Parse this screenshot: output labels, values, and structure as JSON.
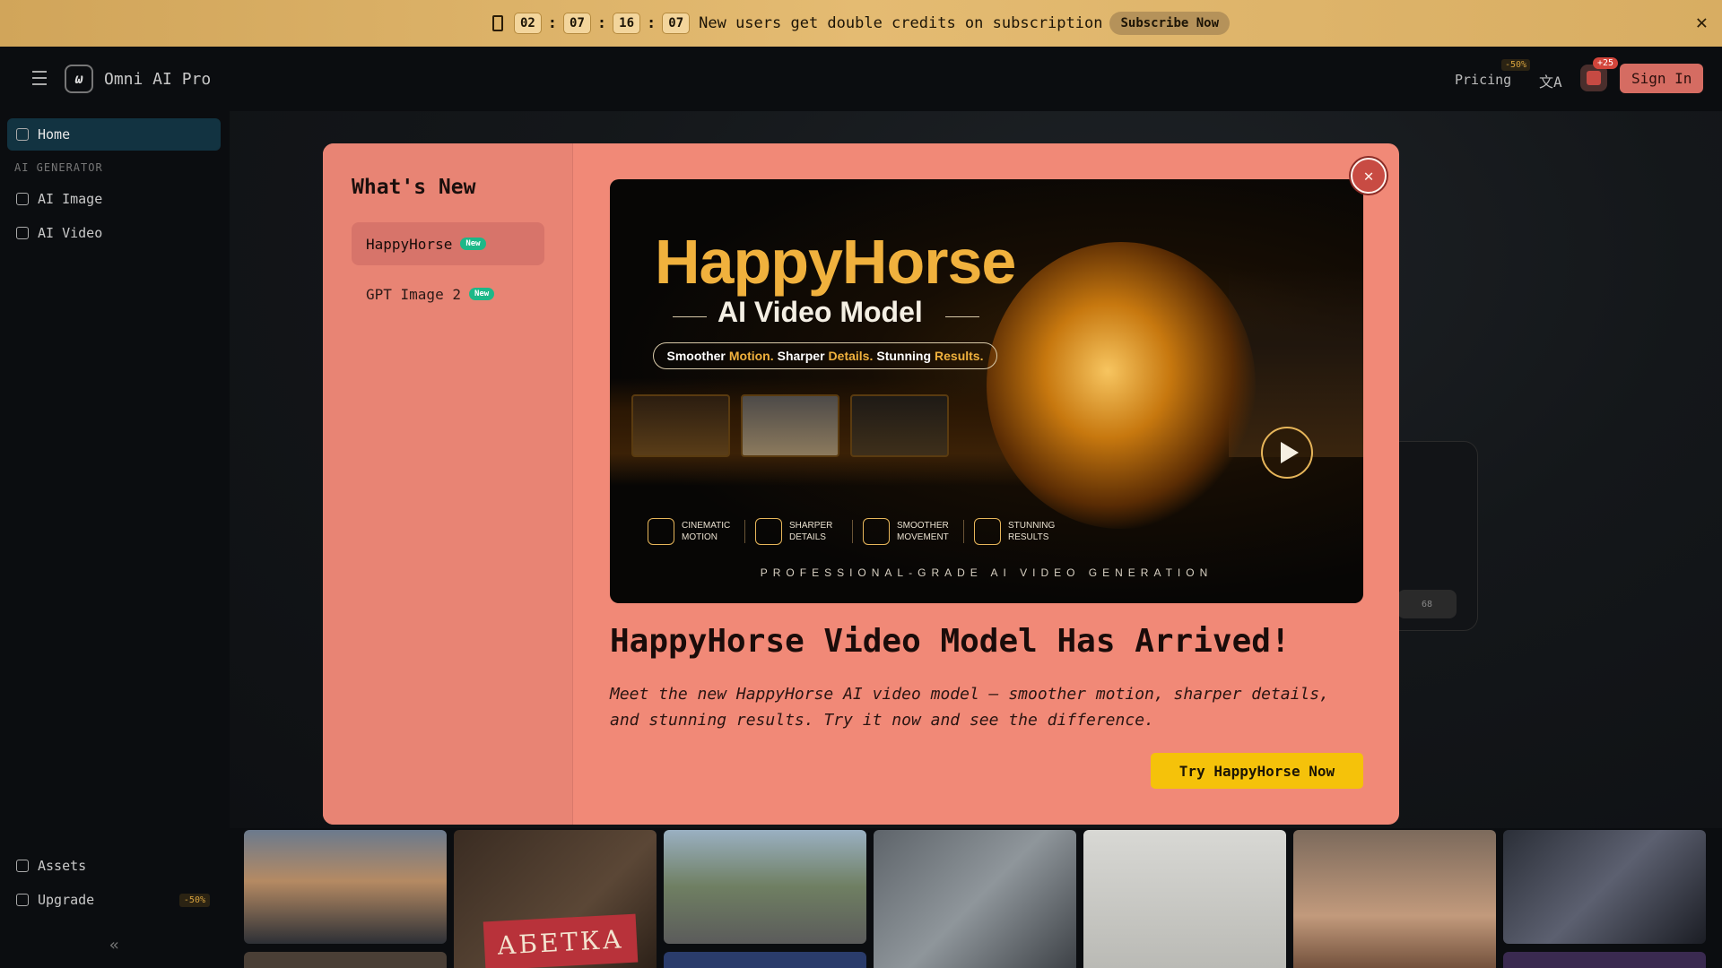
{
  "promo": {
    "timer": [
      "02",
      "07",
      "16",
      "07"
    ],
    "message": "New users get double credits on subscription",
    "button": "Subscribe Now",
    "close": "✕"
  },
  "header": {
    "brand": "Omni AI Pro",
    "logo_glyph": "ω",
    "pricing": "Pricing",
    "pricing_badge": "-50%",
    "translate_glyph": "文A",
    "gift_badge": "+25",
    "signin": "Sign In"
  },
  "sidebar": {
    "home": "Home",
    "section": "AI GENERATOR",
    "items": [
      "AI Image",
      "AI Video"
    ],
    "assets": "Assets",
    "upgrade": "Upgrade",
    "upgrade_badge": "-50%",
    "collapse": "«"
  },
  "modal": {
    "title": "What's New",
    "tabs": [
      {
        "label": "HappyHorse",
        "badge": "New"
      },
      {
        "label": "GPT Image 2",
        "badge": "New"
      }
    ],
    "close": "✕",
    "hero": {
      "title": "HappyHorse",
      "subtitle": "AI Video Model",
      "pill": {
        "p1": "Smoother",
        "h1": "Motion.",
        "p2": "Sharper",
        "h2": "Details.",
        "p3": "Stunning",
        "h3": "Results."
      },
      "features": [
        {
          "l1": "CINEMATIC",
          "l2": "MOTION"
        },
        {
          "l1": "SHARPER",
          "l2": "DETAILS"
        },
        {
          "l1": "SMOOTHER",
          "l2": "MOVEMENT"
        },
        {
          "l1": "STUNNING",
          "l2": "RESULTS"
        }
      ],
      "footer": "PROFESSIONAL-GRADE AI VIDEO GENERATION"
    },
    "headline": "HappyHorse Video Model Has Arrived!",
    "description": "Meet the new HappyHorse AI video model — smoother motion, sharper details, and stunning results. Try it now and see the difference.",
    "cta": "Try HappyHorse Now"
  },
  "background": {
    "card_chip": "68",
    "thumb_text": "АБЕТКА"
  },
  "colors": {
    "modal_bg": "#f18977",
    "accent_yellow": "#f5c20a",
    "new_badge": "#1db888",
    "promo_bg": "#d8ad62"
  }
}
